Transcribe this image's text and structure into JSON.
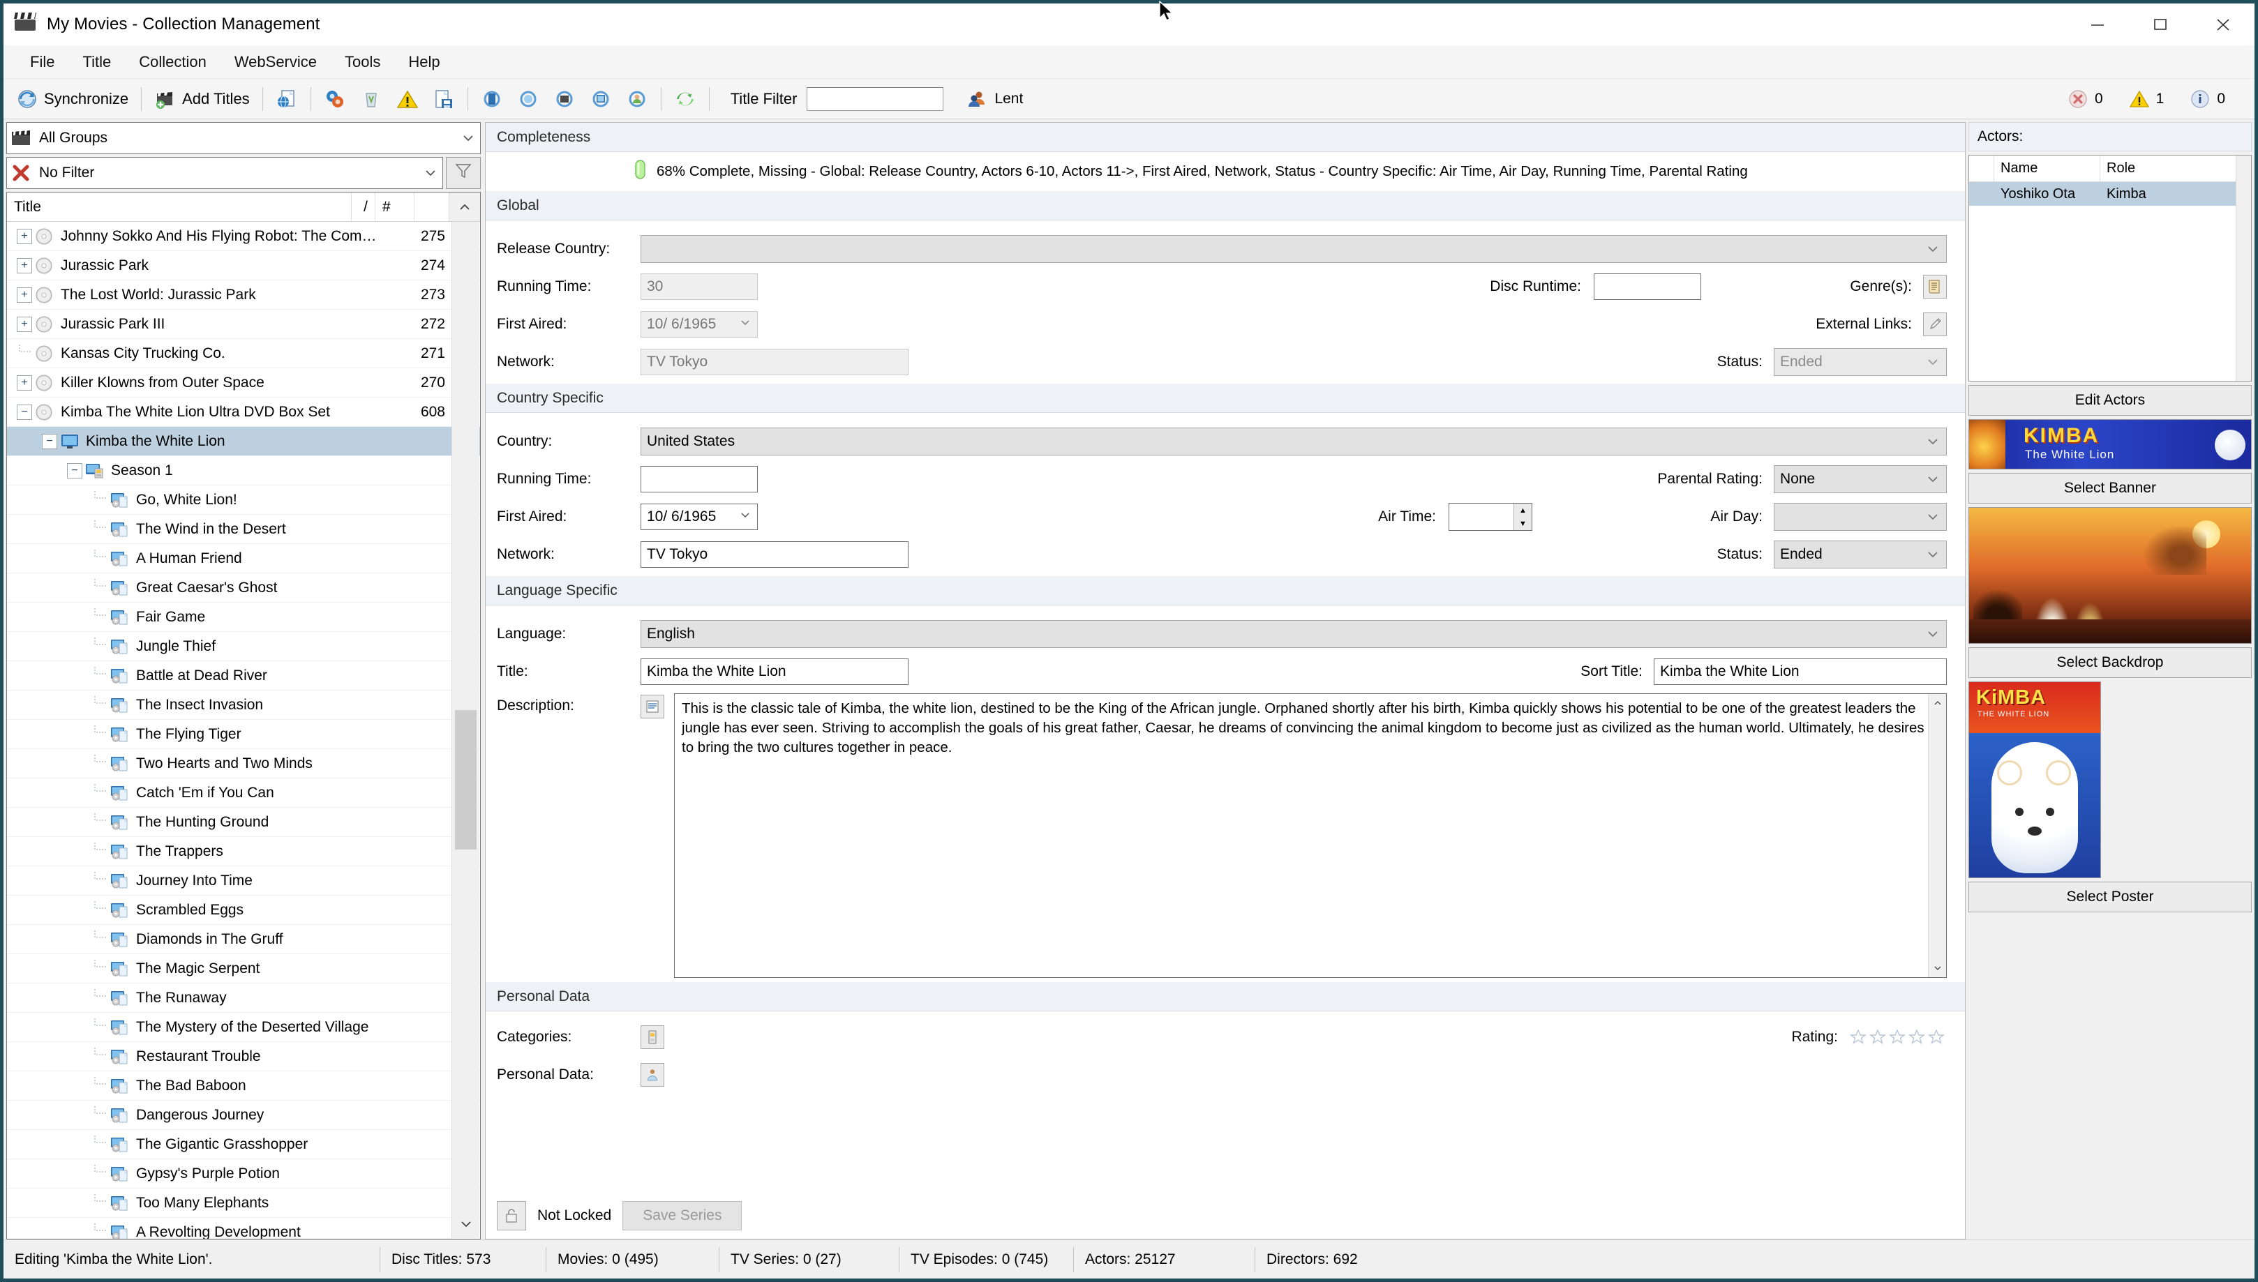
{
  "window": {
    "title": "My Movies - Collection Management",
    "icon": "clapperboard-icon",
    "minimize": "–",
    "maximize": "□",
    "close": "✕"
  },
  "menubar": {
    "items": [
      "File",
      "Title",
      "Collection",
      "WebService",
      "Tools",
      "Help"
    ]
  },
  "toolbar": {
    "synchronize": "Synchronize",
    "add_titles": "Add Titles",
    "title_filter_label": "Title Filter",
    "title_filter_value": "",
    "title_filter_placeholder": "",
    "lent": "Lent",
    "errors": "0",
    "warnings": "1",
    "infos": "0"
  },
  "left": {
    "group_combo": "All Groups",
    "filter_combo": "No Filter",
    "columns": {
      "title": "Title",
      "slash": "/",
      "hash": "#"
    },
    "rows": [
      {
        "indent": 0,
        "expander": "+",
        "icon": "disc-icon",
        "title": "Johnny Sokko And His Flying Robot: The Com…",
        "num": "275",
        "pill": true
      },
      {
        "indent": 0,
        "expander": "+",
        "icon": "disc-icon",
        "title": "Jurassic Park",
        "num": "274",
        "pill": true
      },
      {
        "indent": 0,
        "expander": "+",
        "icon": "disc-icon",
        "title": "The Lost World: Jurassic Park",
        "num": "273",
        "pill": true
      },
      {
        "indent": 0,
        "expander": "+",
        "icon": "disc-icon",
        "title": "Jurassic Park III",
        "num": "272",
        "pill": true
      },
      {
        "indent": 0,
        "expander": "",
        "icon": "disc-icon",
        "title": "Kansas City Trucking Co.",
        "num": "271",
        "pill": true
      },
      {
        "indent": 0,
        "expander": "+",
        "icon": "disc-icon",
        "title": "Killer Klowns from Outer Space",
        "num": "270",
        "pill": true
      },
      {
        "indent": 0,
        "expander": "−",
        "icon": "disc-icon",
        "title": "Kimba The White Lion Ultra DVD Box Set",
        "num": "608",
        "pill": true
      },
      {
        "indent": 1,
        "expander": "−",
        "icon": "tv-icon",
        "title": "Kimba the White Lion",
        "num": "",
        "pill": false,
        "selected": true
      },
      {
        "indent": 2,
        "expander": "−",
        "icon": "season-icon",
        "title": "Season 1",
        "num": "",
        "pill": false
      },
      {
        "indent": 3,
        "expander": "",
        "icon": "episode-icon",
        "title": "Go, White Lion!",
        "num": "",
        "pill": false
      },
      {
        "indent": 3,
        "expander": "",
        "icon": "episode-icon",
        "title": "The Wind in the Desert",
        "num": "",
        "pill": false
      },
      {
        "indent": 3,
        "expander": "",
        "icon": "episode-icon",
        "title": "A Human Friend",
        "num": "",
        "pill": false
      },
      {
        "indent": 3,
        "expander": "",
        "icon": "episode-icon",
        "title": "Great Caesar's Ghost",
        "num": "",
        "pill": false
      },
      {
        "indent": 3,
        "expander": "",
        "icon": "episode-icon",
        "title": "Fair Game",
        "num": "",
        "pill": false
      },
      {
        "indent": 3,
        "expander": "",
        "icon": "episode-icon",
        "title": "Jungle Thief",
        "num": "",
        "pill": false
      },
      {
        "indent": 3,
        "expander": "",
        "icon": "episode-icon",
        "title": "Battle at Dead River",
        "num": "",
        "pill": false
      },
      {
        "indent": 3,
        "expander": "",
        "icon": "episode-icon",
        "title": "The Insect Invasion",
        "num": "",
        "pill": false
      },
      {
        "indent": 3,
        "expander": "",
        "icon": "episode-icon",
        "title": "The Flying Tiger",
        "num": "",
        "pill": false
      },
      {
        "indent": 3,
        "expander": "",
        "icon": "episode-icon",
        "title": "Two Hearts and Two Minds",
        "num": "",
        "pill": false
      },
      {
        "indent": 3,
        "expander": "",
        "icon": "episode-icon",
        "title": "Catch 'Em if You Can",
        "num": "",
        "pill": false
      },
      {
        "indent": 3,
        "expander": "",
        "icon": "episode-icon",
        "title": "The Hunting Ground",
        "num": "",
        "pill": false
      },
      {
        "indent": 3,
        "expander": "",
        "icon": "episode-icon",
        "title": "The Trappers",
        "num": "",
        "pill": false
      },
      {
        "indent": 3,
        "expander": "",
        "icon": "episode-icon",
        "title": "Journey Into Time",
        "num": "",
        "pill": false
      },
      {
        "indent": 3,
        "expander": "",
        "icon": "episode-icon",
        "title": "Scrambled Eggs",
        "num": "",
        "pill": false
      },
      {
        "indent": 3,
        "expander": "",
        "icon": "episode-icon",
        "title": "Diamonds in The Gruff",
        "num": "",
        "pill": false
      },
      {
        "indent": 3,
        "expander": "",
        "icon": "episode-icon",
        "title": "The Magic Serpent",
        "num": "",
        "pill": false
      },
      {
        "indent": 3,
        "expander": "",
        "icon": "episode-icon",
        "title": "The Runaway",
        "num": "",
        "pill": false
      },
      {
        "indent": 3,
        "expander": "",
        "icon": "episode-icon",
        "title": "The Mystery of the Deserted Village",
        "num": "",
        "pill": false
      },
      {
        "indent": 3,
        "expander": "",
        "icon": "episode-icon",
        "title": "Restaurant Trouble",
        "num": "",
        "pill": false
      },
      {
        "indent": 3,
        "expander": "",
        "icon": "episode-icon",
        "title": "The Bad Baboon",
        "num": "",
        "pill": false
      },
      {
        "indent": 3,
        "expander": "",
        "icon": "episode-icon",
        "title": "Dangerous Journey",
        "num": "",
        "pill": false
      },
      {
        "indent": 3,
        "expander": "",
        "icon": "episode-icon",
        "title": "The Gigantic Grasshopper",
        "num": "",
        "pill": false
      },
      {
        "indent": 3,
        "expander": "",
        "icon": "episode-icon",
        "title": "Gypsy's Purple Potion",
        "num": "",
        "pill": false
      },
      {
        "indent": 3,
        "expander": "",
        "icon": "episode-icon",
        "title": "Too Many Elephants",
        "num": "",
        "pill": false
      },
      {
        "indent": 3,
        "expander": "",
        "icon": "episode-icon",
        "title": "A Revolting Development",
        "num": "",
        "pill": false
      }
    ]
  },
  "completeness": {
    "header": "Completeness",
    "text": "68% Complete, Missing - Global: Release Country, Actors 6-10, Actors 11->, First Aired, Network, Status - Country Specific: Air Time, Air Day, Running Time, Parental Rating",
    "percent": "68"
  },
  "global": {
    "header": "Global",
    "release_country_label": "Release Country:",
    "release_country_value": "",
    "running_time_label": "Running Time:",
    "running_time_value": "30",
    "disc_runtime_label": "Disc Runtime:",
    "disc_runtime_value": "",
    "first_aired_label": "First Aired:",
    "first_aired_value": "10/  6/1965",
    "network_label": "Network:",
    "network_value": "TV Tokyo",
    "genres_label": "Genre(s):",
    "external_links_label": "External Links:",
    "status_label": "Status:",
    "status_value": "Ended"
  },
  "country_specific": {
    "header": "Country Specific",
    "country_label": "Country:",
    "country_value": "United States",
    "running_time_label": "Running Time:",
    "running_time_value": "",
    "first_aired_label": "First Aired:",
    "first_aired_value": "10/  6/1965",
    "air_time_label": "Air Time:",
    "air_time_value": "",
    "network_label": "Network:",
    "network_value": "TV Tokyo",
    "parental_rating_label": "Parental Rating:",
    "parental_rating_value": "None",
    "air_day_label": "Air Day:",
    "air_day_value": "",
    "status_label": "Status:",
    "status_value": "Ended"
  },
  "language_specific": {
    "header": "Language Specific",
    "language_label": "Language:",
    "language_value": "English",
    "title_label": "Title:",
    "title_value": "Kimba the White Lion",
    "sort_title_label": "Sort Title:",
    "sort_title_value": "Kimba the White Lion",
    "description_label": "Description:",
    "description_value": "This is the classic tale of Kimba, the white lion, destined to be the King of the African jungle. Orphaned shortly after his birth, Kimba quickly shows his potential to be one of the greatest leaders the jungle has ever seen. Striving to accomplish the goals of his great father, Caesar, he dreams of convincing the animal kingdom to become just as civilized as the human world. Ultimately, he desires to bring the two cultures together in peace."
  },
  "personal_data": {
    "header": "Personal Data",
    "categories_label": "Categories:",
    "personal_data_label": "Personal Data:",
    "rating_label": "Rating:",
    "rating_stars": 0,
    "rating_max": 5
  },
  "footer": {
    "not_locked": "Not Locked",
    "save_series": "Save Series"
  },
  "right": {
    "actors_header": "Actors:",
    "actors_columns": [
      "",
      "Name",
      "Role"
    ],
    "actors_rows": [
      {
        "name": "Yoshiko Ota",
        "role": "Kimba"
      }
    ],
    "edit_actors": "Edit Actors",
    "select_banner": "Select Banner",
    "select_backdrop": "Select Backdrop",
    "select_poster": "Select Poster",
    "banner_title": "KIMBA",
    "banner_subtitle": "The White Lion",
    "poster_title": "KiMBA",
    "poster_subtitle": "THE WHITE LION"
  },
  "statusbar": {
    "message": "Editing 'Kimba the White Lion'.",
    "disc_titles": "Disc Titles: 573",
    "movies": "Movies: 0 (495)",
    "tv_series": "TV Series: 0 (27)",
    "tv_episodes": "TV Episodes: 0 (745)",
    "actors": "Actors: 25127",
    "directors": "Directors: 692"
  }
}
